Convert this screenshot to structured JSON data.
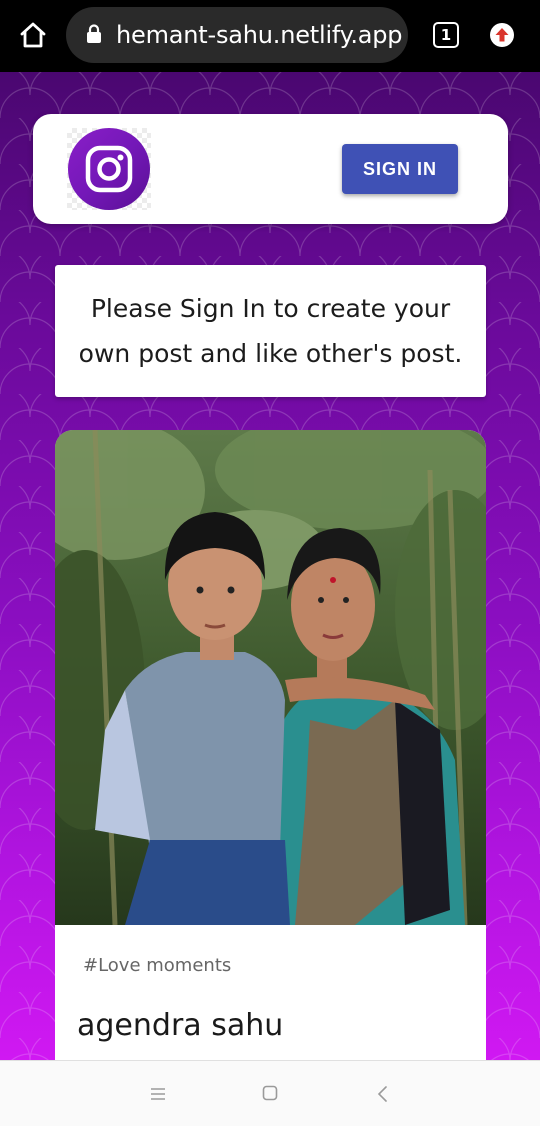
{
  "browser": {
    "url": "hemant-sahu.netlify.app",
    "tab_count": "1"
  },
  "header": {
    "logo": "instagram-icon",
    "signin_label": "SIGN IN",
    "signin_color": "#3f51b5"
  },
  "notice": {
    "text": "Please Sign In to create your own post and like other's post."
  },
  "post": {
    "caption": "#Love moments",
    "author": "agendra sahu"
  },
  "colors": {
    "background_top": "#4a0770",
    "background_bottom": "#d018f2",
    "logo_purple": "#7418b8"
  }
}
